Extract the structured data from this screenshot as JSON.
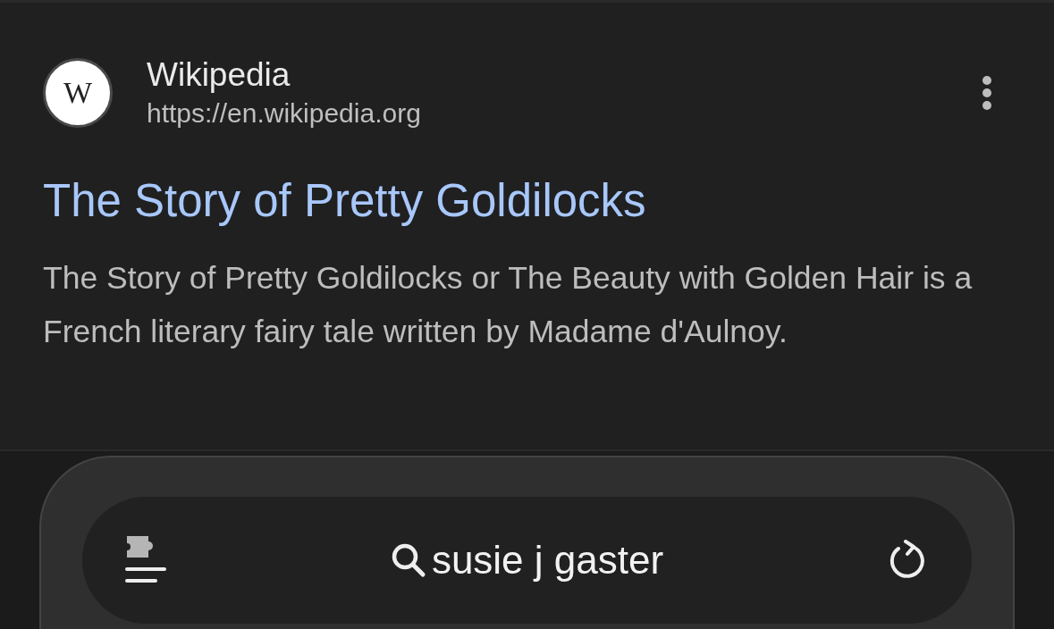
{
  "result": {
    "site_name": "Wikipedia",
    "favicon_letter": "W",
    "url": "https://en.wikipedia.org",
    "title": "The Story of Pretty Goldilocks",
    "snippet": "The Story of Pretty Goldilocks or The Beauty with Golden Hair is a French literary fairy tale written by Madame d'Aulnoy."
  },
  "address_bar": {
    "query": "susie j gaster"
  }
}
